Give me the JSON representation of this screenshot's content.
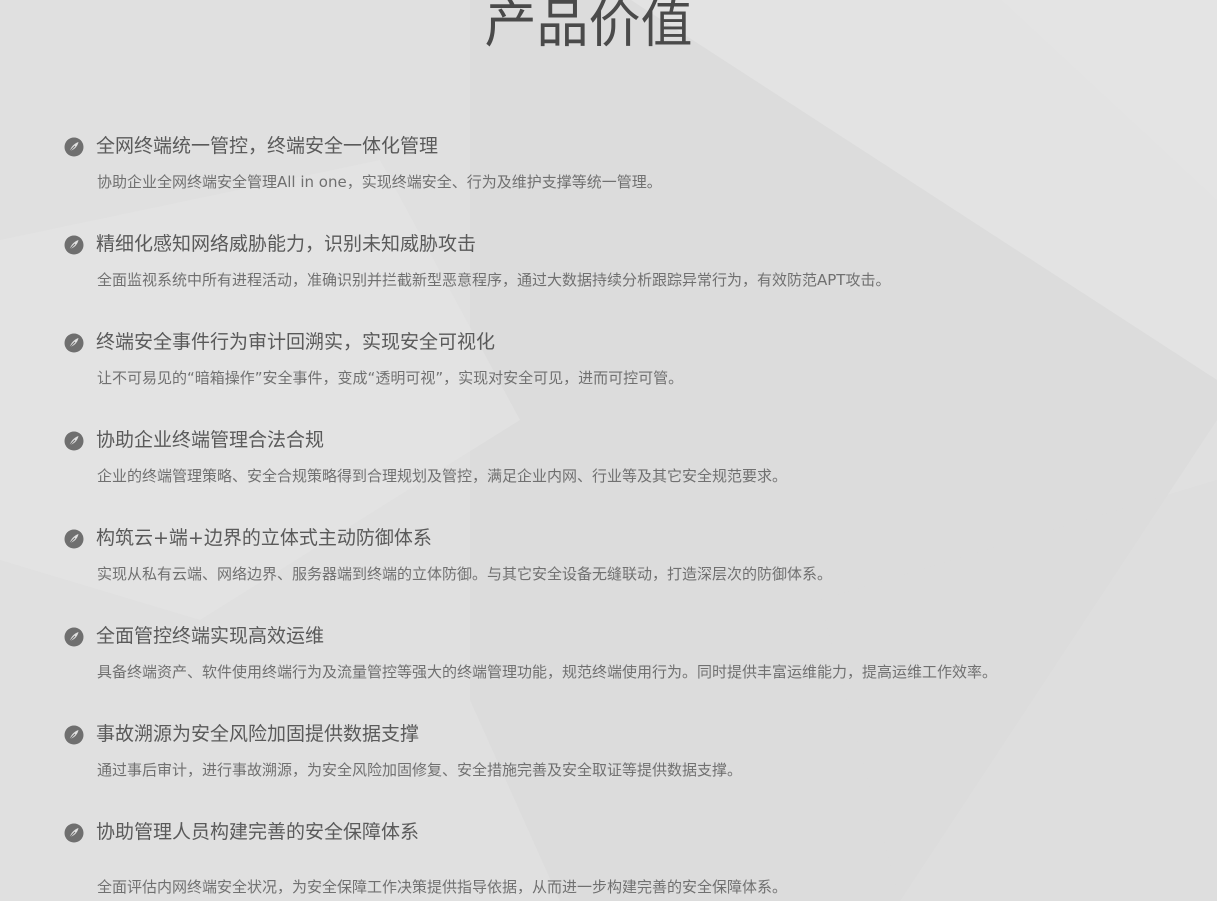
{
  "section": {
    "title": "产品价值"
  },
  "items": [
    {
      "heading": "全网终端统一管控，终端安全一体化管理",
      "desc": "协助企业全网终端安全管理All in one，实现终端安全、行为及维护支撑等统一管理。",
      "icon": "leaf-icon"
    },
    {
      "heading": "精细化感知网络威胁能力，识别未知威胁攻击",
      "desc": "全面监视系统中所有进程活动，准确识别并拦截新型恶意程序，通过大数据持续分析跟踪异常行为，有效防范APT攻击。",
      "icon": "leaf-icon"
    },
    {
      "heading": "终端安全事件行为审计回溯实，实现安全可视化",
      "desc": "让不可易见的“暗箱操作”安全事件，变成“透明可视”，实现对安全可见，进而可控可管。",
      "icon": "leaf-icon"
    },
    {
      "heading": "协助企业终端管理合法合规",
      "desc": "企业的终端管理策略、安全合规策略得到合理规划及管控，满足企业内网、行业等及其它安全规范要求。",
      "icon": "leaf-icon"
    },
    {
      "heading": "构筑云+端+边界的立体式主动防御体系",
      "desc": "实现从私有云端、网络边界、服务器端到终端的立体防御。与其它安全设备无缝联动，打造深层次的防御体系。",
      "icon": "leaf-icon"
    },
    {
      "heading": "全面管控终端实现高效运维",
      "desc": "具备终端资产、软件使用终端行为及流量管控等强大的终端管理功能，规范终端使用行为。同时提供丰富运维能力，提高运维工作效率。",
      "icon": "leaf-icon"
    },
    {
      "heading": "事故溯源为安全风险加固提供数据支撑",
      "desc": "通过事后审计，进行事故溯源，为安全风险加固修复、安全措施完善及安全取证等提供数据支撑。",
      "icon": "leaf-icon"
    },
    {
      "heading": "协助管理人员构建完善的安全保障体系",
      "desc": "全面评估内网终端安全状况，为安全保障工作决策提供指导依据，从而进一步构建完善的安全保障体系。",
      "icon": "leaf-icon"
    }
  ],
  "colors": {
    "background": "#e0e0e0",
    "title": "#4a4a4a",
    "heading": "#5a5a5a",
    "desc": "#707070",
    "icon": "#6f6f6f"
  }
}
